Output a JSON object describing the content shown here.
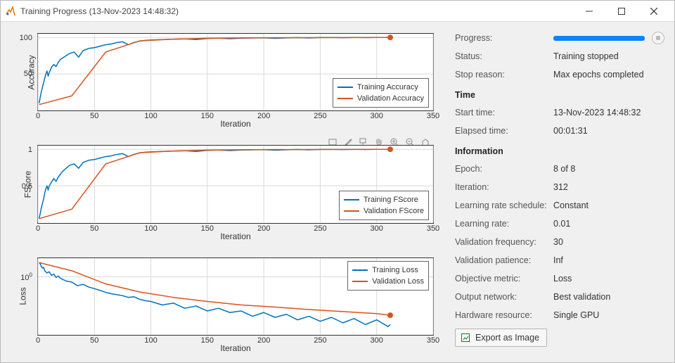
{
  "window": {
    "title": "Training Progress (13-Nov-2023 14:48:32)"
  },
  "side": {
    "progress_label": "Progress:",
    "progress_value": 100,
    "status_label": "Status:",
    "status_value": "Training stopped",
    "stopreason_label": "Stop reason:",
    "stopreason_value": "Max epochs completed",
    "time_header": "Time",
    "start_label": "Start time:",
    "start_value": "13-Nov-2023 14:48:32",
    "elapsed_label": "Elapsed time:",
    "elapsed_value": "00:01:31",
    "info_header": "Information",
    "epoch_label": "Epoch:",
    "epoch_value": "8 of 8",
    "iteration_label": "Iteration:",
    "iteration_value": "312",
    "lrs_label": "Learning rate schedule:",
    "lrs_value": "Constant",
    "lr_label": "Learning rate:",
    "lr_value": "0.01",
    "vf_label": "Validation frequency:",
    "vf_value": "30",
    "vp_label": "Validation patience:",
    "vp_value": "Inf",
    "om_label": "Objective metric:",
    "om_value": "Loss",
    "on_label": "Output network:",
    "on_value": "Best validation",
    "hw_label": "Hardware resource:",
    "hw_value": "Single GPU",
    "export_label": "Export as Image"
  },
  "colors": {
    "train": "#0072BD",
    "valid": "#D95319",
    "grid": "#d9d9d9",
    "axis": "#333333",
    "progress": "#0a84ff"
  },
  "chart_data": [
    {
      "type": "line",
      "name": "accuracy",
      "title": "",
      "xlabel": "Iteration",
      "ylabel": "Accuracy",
      "xlim": [
        0,
        350
      ],
      "ylim": [
        0,
        105
      ],
      "xticks": [
        0,
        50,
        100,
        150,
        200,
        250,
        300,
        350
      ],
      "yticks": [
        50,
        100
      ],
      "legend": {
        "pos": "bottom-right-in"
      },
      "series": [
        {
          "name": "Training Accuracy",
          "color": "train",
          "x": [
            1,
            2,
            3,
            4,
            5,
            6,
            7,
            8,
            9,
            10,
            12,
            14,
            16,
            18,
            20,
            22,
            25,
            28,
            32,
            36,
            40,
            45,
            50,
            55,
            60,
            65,
            70,
            75,
            80,
            85,
            90,
            95,
            100,
            110,
            120,
            130,
            140,
            150,
            160,
            170,
            180,
            190,
            200,
            210,
            220,
            230,
            240,
            250,
            260,
            270,
            280,
            290,
            300,
            310,
            312
          ],
          "values": [
            10,
            18,
            26,
            32,
            38,
            44,
            50,
            54,
            47,
            52,
            59,
            63,
            60,
            66,
            70,
            72,
            75,
            78,
            80,
            73,
            82,
            85,
            86,
            88,
            90,
            91,
            93,
            94,
            90,
            93,
            95,
            96,
            96.5,
            97,
            97.5,
            98,
            97,
            98.5,
            99,
            98.2,
            99,
            99.2,
            99.5,
            98.7,
            99.4,
            99.7,
            99.2,
            99.8,
            99.9,
            99.6,
            100,
            99.7,
            100,
            99.9,
            100
          ]
        },
        {
          "name": "Validation Accuracy",
          "color": "valid",
          "marker_end": true,
          "x": [
            1,
            30,
            60,
            90,
            120,
            150,
            180,
            210,
            240,
            270,
            300,
            312
          ],
          "values": [
            8,
            20,
            80,
            95.2,
            97.6,
            98.8,
            99.4,
            99.6,
            99.7,
            99.8,
            99.9,
            100
          ]
        }
      ]
    },
    {
      "type": "line",
      "name": "fscore",
      "title": "",
      "xlabel": "Iteration",
      "ylabel": "FScore",
      "xlim": [
        0,
        350
      ],
      "ylim": [
        0,
        1.05
      ],
      "xticks": [
        0,
        50,
        100,
        150,
        200,
        250,
        300,
        350
      ],
      "yticks": [
        0.5,
        1
      ],
      "legend": {
        "pos": "bottom-right-in"
      },
      "series": [
        {
          "name": "Training FScore",
          "color": "train",
          "x": [
            1,
            2,
            3,
            4,
            5,
            6,
            7,
            8,
            9,
            10,
            12,
            14,
            16,
            18,
            20,
            22,
            25,
            28,
            32,
            36,
            40,
            45,
            50,
            55,
            60,
            65,
            70,
            75,
            80,
            85,
            90,
            95,
            100,
            110,
            120,
            130,
            140,
            150,
            160,
            170,
            180,
            190,
            200,
            210,
            220,
            230,
            240,
            250,
            260,
            270,
            280,
            290,
            300,
            310,
            312
          ],
          "values": [
            0.05,
            0.12,
            0.2,
            0.26,
            0.32,
            0.4,
            0.46,
            0.5,
            0.44,
            0.5,
            0.55,
            0.6,
            0.56,
            0.62,
            0.66,
            0.7,
            0.74,
            0.78,
            0.8,
            0.74,
            0.82,
            0.85,
            0.86,
            0.88,
            0.9,
            0.91,
            0.93,
            0.94,
            0.9,
            0.93,
            0.95,
            0.96,
            0.965,
            0.97,
            0.975,
            0.98,
            0.97,
            0.985,
            0.99,
            0.982,
            0.99,
            0.992,
            0.995,
            0.987,
            0.994,
            0.997,
            0.992,
            0.998,
            0.999,
            0.996,
            1.0,
            0.997,
            1.0,
            0.999,
            1.0
          ]
        },
        {
          "name": "Validation FScore",
          "color": "valid",
          "marker_end": true,
          "x": [
            1,
            30,
            60,
            90,
            120,
            150,
            180,
            210,
            240,
            270,
            300,
            312
          ],
          "values": [
            0.05,
            0.18,
            0.8,
            0.952,
            0.976,
            0.988,
            0.994,
            0.996,
            0.997,
            0.998,
            0.999,
            1.0
          ]
        }
      ]
    },
    {
      "type": "line",
      "name": "loss",
      "title": "",
      "xlabel": "Iteration",
      "ylabel": "Loss",
      "xlim": [
        0,
        350
      ],
      "yscale": "log",
      "ylim": [
        0.02,
        3.5
      ],
      "xticks": [
        0,
        50,
        100,
        150,
        200,
        250,
        300,
        350
      ],
      "yticks_labeled": [
        {
          "v": 1,
          "label": "10^0"
        }
      ],
      "legend": {
        "pos": "top-right-in"
      },
      "series": [
        {
          "name": "Training Loss",
          "color": "train",
          "x": [
            1,
            2,
            3,
            4,
            5,
            6,
            8,
            10,
            12,
            14,
            16,
            18,
            20,
            25,
            30,
            35,
            40,
            45,
            50,
            55,
            60,
            65,
            70,
            75,
            80,
            85,
            90,
            95,
            100,
            110,
            120,
            130,
            140,
            150,
            160,
            170,
            180,
            190,
            200,
            210,
            220,
            230,
            240,
            250,
            260,
            270,
            280,
            290,
            300,
            310,
            312
          ],
          "values": [
            2.6,
            2.4,
            2.0,
            1.8,
            1.9,
            1.5,
            1.3,
            1.4,
            1.1,
            1.2,
            0.95,
            1.05,
            0.9,
            0.75,
            0.7,
            0.55,
            0.6,
            0.5,
            0.45,
            0.4,
            0.35,
            0.32,
            0.3,
            0.28,
            0.25,
            0.26,
            0.22,
            0.2,
            0.19,
            0.15,
            0.17,
            0.12,
            0.14,
            0.1,
            0.12,
            0.09,
            0.1,
            0.07,
            0.09,
            0.065,
            0.08,
            0.055,
            0.07,
            0.05,
            0.065,
            0.045,
            0.06,
            0.04,
            0.055,
            0.035,
            0.04
          ]
        },
        {
          "name": "Validation Loss",
          "color": "valid",
          "marker_end": true,
          "x": [
            1,
            30,
            60,
            90,
            120,
            150,
            180,
            210,
            240,
            270,
            300,
            312
          ],
          "values": [
            2.6,
            1.5,
            0.62,
            0.36,
            0.25,
            0.19,
            0.15,
            0.13,
            0.11,
            0.096,
            0.084,
            0.075
          ]
        }
      ]
    }
  ]
}
